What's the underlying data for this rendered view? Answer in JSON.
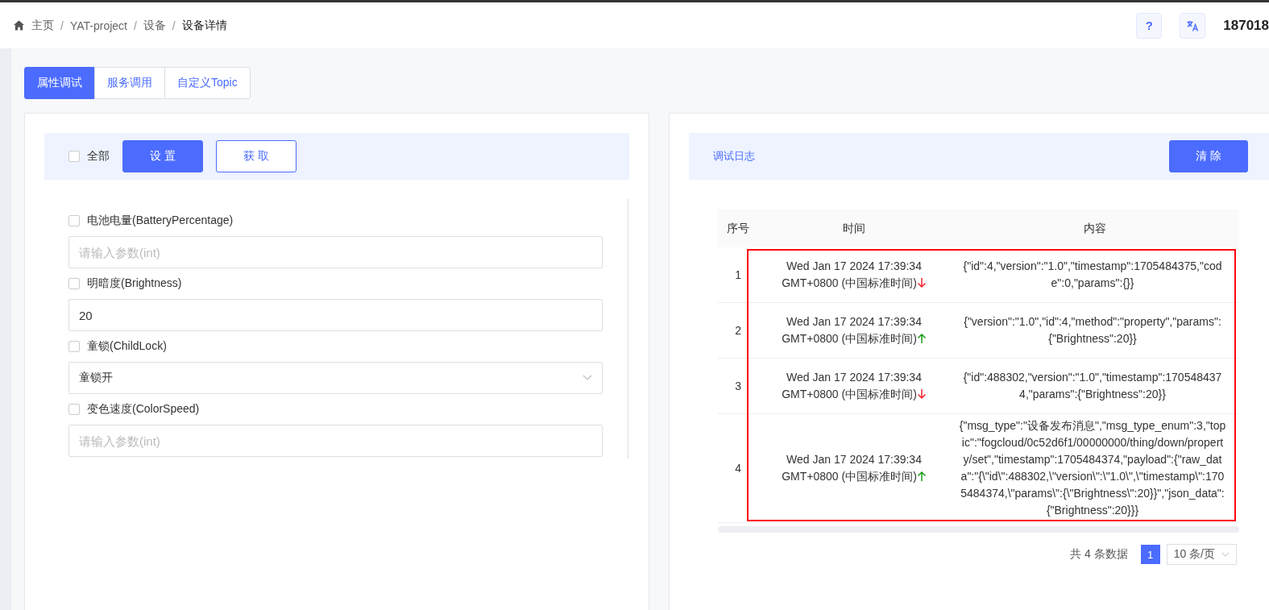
{
  "breadcrumb": [
    {
      "label": "主页",
      "current": false
    },
    {
      "label": "YAT-project",
      "current": false
    },
    {
      "label": "设备",
      "current": false
    },
    {
      "label": "设备详情",
      "current": true
    }
  ],
  "breadcrumb_separator": "/",
  "header": {
    "help": "?",
    "user": "187018"
  },
  "tabs": [
    {
      "label": "属性调试",
      "selected": true
    },
    {
      "label": "服务调用",
      "selected": false
    },
    {
      "label": "自定义Topic",
      "selected": false
    }
  ],
  "properties": {
    "select_all": {
      "label": "全部",
      "checked": false
    },
    "buttons": [
      {
        "label": "设 置",
        "kind": "primary"
      },
      {
        "label": "获 取",
        "kind": "outline"
      }
    ],
    "items": [
      {
        "label": "电池电量(BatteryPercentage)",
        "checked": false,
        "kind": "input",
        "placeholder": "请输入参数(int)"
      },
      {
        "label": "明暗度(Brightness)",
        "checked": false,
        "kind": "input",
        "value": "20"
      },
      {
        "label": "童锁(ChildLock)",
        "checked": false,
        "kind": "select",
        "value": "童锁开"
      },
      {
        "label": "变色速度(ColorSpeed)",
        "checked": false,
        "kind": "input",
        "placeholder": "请输入参数(int)"
      }
    ]
  },
  "log": {
    "title": "调试日志",
    "clear_button": "清 除",
    "highlighted": true,
    "columns": [
      "序号",
      "时间",
      "内容"
    ],
    "rows": [
      {
        "index": "1",
        "time": "Wed Jan 17 2024 17:39:34 GMT+0800 (中国标准时间)",
        "downlink": true,
        "content": "{\"id\":4,\"version\":\"1.0\",\"timestamp\":1705484375,\"code\":0,\"params\":{}}"
      },
      {
        "index": "2",
        "time": "Wed Jan 17 2024 17:39:34 GMT+0800 (中国标准时间)",
        "downlink": false,
        "content": "{\"version\":\"1.0\",\"id\":4,\"method\":\"property\",\"params\":{\"Brightness\":20}}"
      },
      {
        "index": "3",
        "time": "Wed Jan 17 2024 17:39:34 GMT+0800 (中国标准时间)",
        "downlink": true,
        "content": "{\"id\":488302,\"version\":\"1.0\",\"timestamp\":1705484374,\"params\":{\"Brightness\":20}}"
      },
      {
        "index": "4",
        "time": "Wed Jan 17 2024 17:39:34 GMT+0800 (中国标准时间)",
        "downlink": false,
        "content": "{\"msg_type\":\"设备发布消息\",\"msg_type_enum\":3,\"topic\":\"fogcloud/0c52d6f1/00000000/thing/down/property/set\",\"timestamp\":1705484374,\"payload\":{\"raw_data\":\"{\\\"id\\\":488302,\\\"version\\\":\\\"1.0\\\",\\\"timestamp\\\":1705484374,\\\"params\\\":{\\\"Brightness\\\":20}}\",\"json_data\":{\"Brightness\":20}}}"
      }
    ],
    "pagination": {
      "total": "共 4 条数据",
      "pages": [
        {
          "label": "1",
          "selected": true
        }
      ],
      "page_size": "10 条/页"
    }
  }
}
